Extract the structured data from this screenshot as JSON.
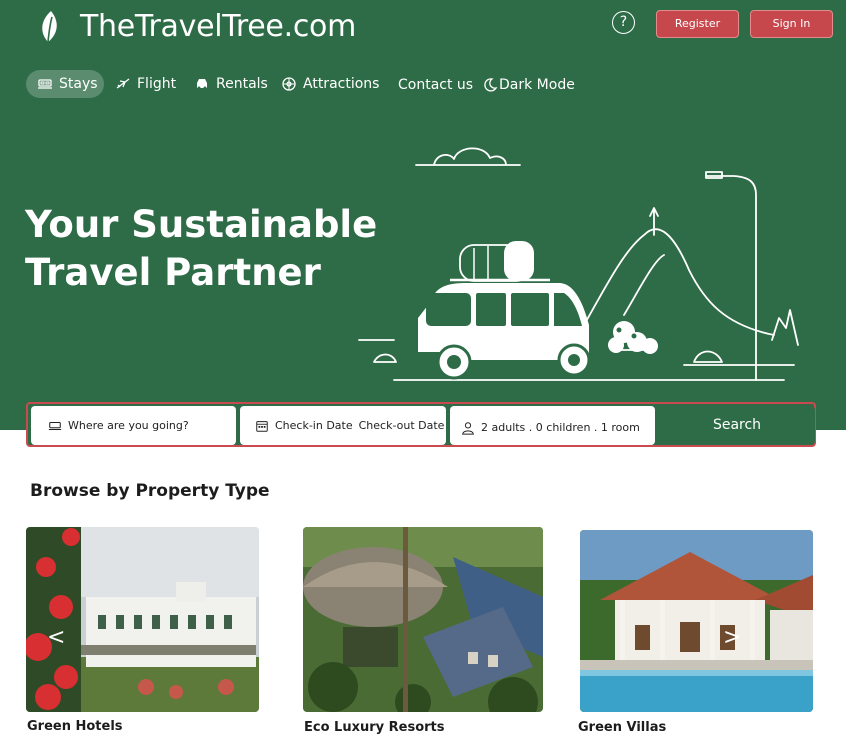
{
  "brand": {
    "name": "TheTravelTree.com",
    "logo_icon": "leaf-icon"
  },
  "header": {
    "help_icon": "question-circle-icon",
    "help_glyph": "?",
    "register_label": "Register",
    "signin_label": "Sign In"
  },
  "nav": {
    "stays": "Stays",
    "flight": "Flight",
    "rentals": "Rentals",
    "attractions": "Attractions",
    "contact": "Contact us",
    "dark_mode": "Dark Mode"
  },
  "hero": {
    "line1": "Your Sustainable",
    "line2": "Travel Partner"
  },
  "search": {
    "destination": "Where are you going?",
    "checkin": "Check-in Date",
    "checkout": "Check-out Date",
    "guests": "2 adults . 0 children . 1 room",
    "button": "Search"
  },
  "browse": {
    "title": "Browse by Property Type",
    "prev": "<",
    "next": ">",
    "cards": [
      {
        "label": "Green Hotels"
      },
      {
        "label": "Eco Luxury Resorts"
      },
      {
        "label": "Green Villas"
      }
    ]
  },
  "colors": {
    "brand_green": "#2e6c47",
    "accent_red": "#c6474c",
    "white": "#ffffff"
  }
}
